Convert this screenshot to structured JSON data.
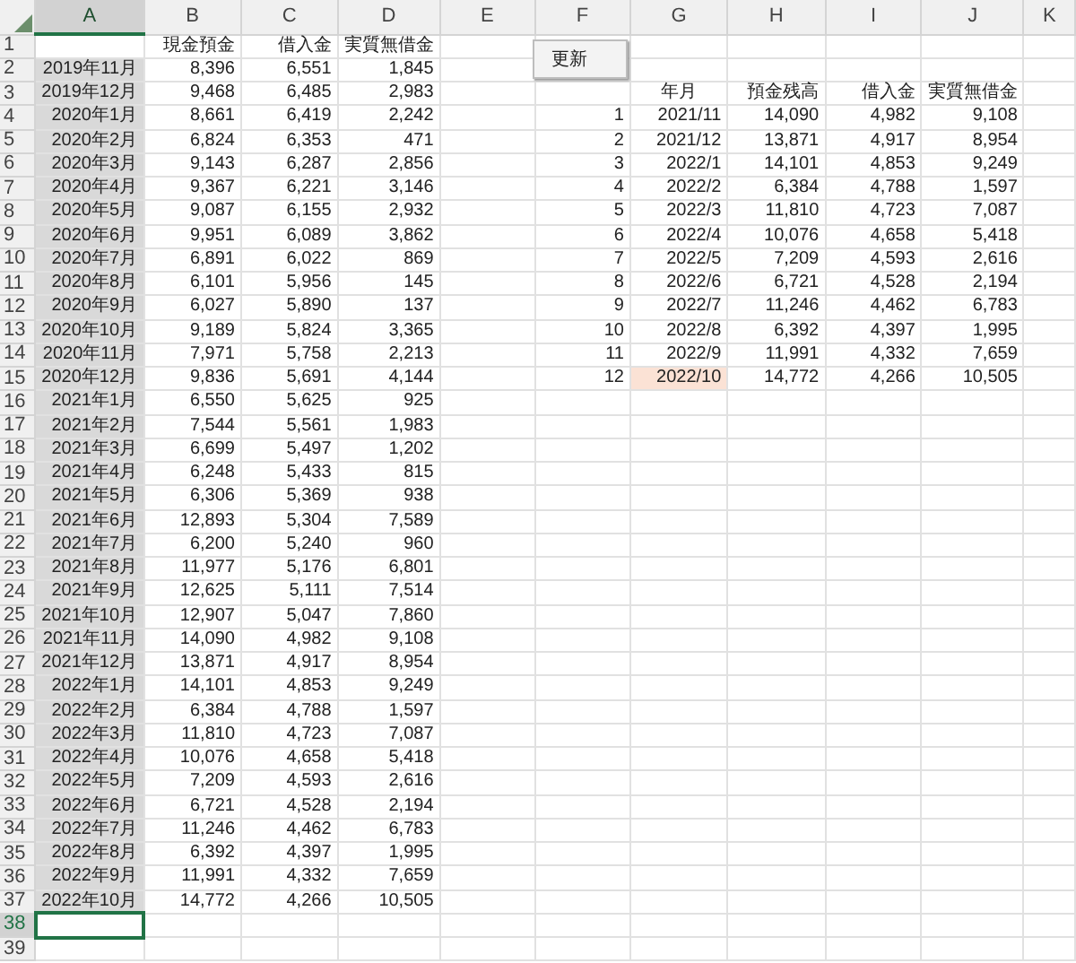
{
  "columns": [
    {
      "label": "A",
      "selected": true
    },
    {
      "label": "B",
      "selected": false
    },
    {
      "label": "C",
      "selected": false
    },
    {
      "label": "D",
      "selected": false
    },
    {
      "label": "E",
      "selected": false
    },
    {
      "label": "F",
      "selected": false
    },
    {
      "label": "G",
      "selected": false
    },
    {
      "label": "H",
      "selected": false
    },
    {
      "label": "I",
      "selected": false
    },
    {
      "label": "J",
      "selected": false
    },
    {
      "label": "K",
      "selected": false
    }
  ],
  "row_numbers": [
    {
      "label": "1",
      "selected": false
    },
    {
      "label": "2",
      "selected": false
    },
    {
      "label": "3",
      "selected": false
    },
    {
      "label": "4",
      "selected": false
    },
    {
      "label": "5",
      "selected": false
    },
    {
      "label": "6",
      "selected": false
    },
    {
      "label": "7",
      "selected": false
    },
    {
      "label": "8",
      "selected": false
    },
    {
      "label": "9",
      "selected": false
    },
    {
      "label": "10",
      "selected": false
    },
    {
      "label": "11",
      "selected": false
    },
    {
      "label": "12",
      "selected": false
    },
    {
      "label": "13",
      "selected": false
    },
    {
      "label": "14",
      "selected": false
    },
    {
      "label": "15",
      "selected": false
    },
    {
      "label": "16",
      "selected": false
    },
    {
      "label": "17",
      "selected": false
    },
    {
      "label": "18",
      "selected": false
    },
    {
      "label": "19",
      "selected": false
    },
    {
      "label": "20",
      "selected": false
    },
    {
      "label": "21",
      "selected": false
    },
    {
      "label": "22",
      "selected": false
    },
    {
      "label": "23",
      "selected": false
    },
    {
      "label": "24",
      "selected": false
    },
    {
      "label": "25",
      "selected": false
    },
    {
      "label": "26",
      "selected": false
    },
    {
      "label": "27",
      "selected": false
    },
    {
      "label": "28",
      "selected": false
    },
    {
      "label": "29",
      "selected": false
    },
    {
      "label": "30",
      "selected": false
    },
    {
      "label": "31",
      "selected": false
    },
    {
      "label": "32",
      "selected": false
    },
    {
      "label": "33",
      "selected": false
    },
    {
      "label": "34",
      "selected": false
    },
    {
      "label": "35",
      "selected": false
    },
    {
      "label": "36",
      "selected": false
    },
    {
      "label": "37",
      "selected": false
    },
    {
      "label": "38",
      "selected": true
    },
    {
      "label": "39",
      "selected": false
    }
  ],
  "button": {
    "label": "更新"
  },
  "left_table": {
    "headers": [
      "現金預金",
      "借入金",
      "実質無借金"
    ],
    "rows": [
      {
        "month": "2019年11月",
        "cash": "8,396",
        "loan": "6,551",
        "net": "1,845",
        "shaded": true
      },
      {
        "month": "2019年12月",
        "cash": "9,468",
        "loan": "6,485",
        "net": "2,983",
        "shaded": true
      },
      {
        "month": "2020年1月",
        "cash": "8,661",
        "loan": "6,419",
        "net": "2,242",
        "shaded": true
      },
      {
        "month": "2020年2月",
        "cash": "6,824",
        "loan": "6,353",
        "net": "471",
        "shaded": true
      },
      {
        "month": "2020年3月",
        "cash": "9,143",
        "loan": "6,287",
        "net": "2,856",
        "shaded": true
      },
      {
        "month": "2020年4月",
        "cash": "9,367",
        "loan": "6,221",
        "net": "3,146",
        "shaded": true
      },
      {
        "month": "2020年5月",
        "cash": "9,087",
        "loan": "6,155",
        "net": "2,932",
        "shaded": true
      },
      {
        "month": "2020年6月",
        "cash": "9,951",
        "loan": "6,089",
        "net": "3,862",
        "shaded": true
      },
      {
        "month": "2020年7月",
        "cash": "6,891",
        "loan": "6,022",
        "net": "869",
        "shaded": true
      },
      {
        "month": "2020年8月",
        "cash": "6,101",
        "loan": "5,956",
        "net": "145",
        "shaded": true
      },
      {
        "month": "2020年9月",
        "cash": "6,027",
        "loan": "5,890",
        "net": "137",
        "shaded": true
      },
      {
        "month": "2020年10月",
        "cash": "9,189",
        "loan": "5,824",
        "net": "3,365",
        "shaded": true
      },
      {
        "month": "2020年11月",
        "cash": "7,971",
        "loan": "5,758",
        "net": "2,213",
        "shaded": true
      },
      {
        "month": "2020年12月",
        "cash": "9,836",
        "loan": "5,691",
        "net": "4,144",
        "shaded": true
      },
      {
        "month": "2021年1月",
        "cash": "6,550",
        "loan": "5,625",
        "net": "925",
        "shaded": true
      },
      {
        "month": "2021年2月",
        "cash": "7,544",
        "loan": "5,561",
        "net": "1,983",
        "shaded": true
      },
      {
        "month": "2021年3月",
        "cash": "6,699",
        "loan": "5,497",
        "net": "1,202",
        "shaded": true
      },
      {
        "month": "2021年4月",
        "cash": "6,248",
        "loan": "5,433",
        "net": "815",
        "shaded": true
      },
      {
        "month": "2021年5月",
        "cash": "6,306",
        "loan": "5,369",
        "net": "938",
        "shaded": true
      },
      {
        "month": "2021年6月",
        "cash": "12,893",
        "loan": "5,304",
        "net": "7,589",
        "shaded": true
      },
      {
        "month": "2021年7月",
        "cash": "6,200",
        "loan": "5,240",
        "net": "960",
        "shaded": true
      },
      {
        "month": "2021年8月",
        "cash": "11,977",
        "loan": "5,176",
        "net": "6,801",
        "shaded": true
      },
      {
        "month": "2021年9月",
        "cash": "12,625",
        "loan": "5,111",
        "net": "7,514",
        "shaded": true
      },
      {
        "month": "2021年10月",
        "cash": "12,907",
        "loan": "5,047",
        "net": "7,860",
        "shaded": true
      },
      {
        "month": "2021年11月",
        "cash": "14,090",
        "loan": "4,982",
        "net": "9,108",
        "shaded": true
      },
      {
        "month": "2021年12月",
        "cash": "13,871",
        "loan": "4,917",
        "net": "8,954",
        "shaded": true
      },
      {
        "month": "2022年1月",
        "cash": "14,101",
        "loan": "4,853",
        "net": "9,249",
        "shaded": true
      },
      {
        "month": "2022年2月",
        "cash": "6,384",
        "loan": "4,788",
        "net": "1,597",
        "shaded": true
      },
      {
        "month": "2022年3月",
        "cash": "11,810",
        "loan": "4,723",
        "net": "7,087",
        "shaded": true
      },
      {
        "month": "2022年4月",
        "cash": "10,076",
        "loan": "4,658",
        "net": "5,418",
        "shaded": true
      },
      {
        "month": "2022年5月",
        "cash": "7,209",
        "loan": "4,593",
        "net": "2,616",
        "shaded": true
      },
      {
        "month": "2022年6月",
        "cash": "6,721",
        "loan": "4,528",
        "net": "2,194",
        "shaded": true
      },
      {
        "month": "2022年7月",
        "cash": "11,246",
        "loan": "4,462",
        "net": "6,783",
        "shaded": true
      },
      {
        "month": "2022年8月",
        "cash": "6,392",
        "loan": "4,397",
        "net": "1,995",
        "shaded": true
      },
      {
        "month": "2022年9月",
        "cash": "11,991",
        "loan": "4,332",
        "net": "7,659",
        "shaded": true
      },
      {
        "month": "2022年10月",
        "cash": "14,772",
        "loan": "4,266",
        "net": "10,505",
        "shaded": true
      }
    ]
  },
  "right_table": {
    "headers": [
      "年月",
      "預金残高",
      "借入金",
      "実質無借金"
    ],
    "rows": [
      {
        "no": "1",
        "month": "2021/11",
        "deposit": "14,090",
        "loan": "4,982",
        "net": "9,108",
        "highlighted": false
      },
      {
        "no": "2",
        "month": "2021/12",
        "deposit": "13,871",
        "loan": "4,917",
        "net": "8,954",
        "highlighted": false
      },
      {
        "no": "3",
        "month": "2022/1",
        "deposit": "14,101",
        "loan": "4,853",
        "net": "9,249",
        "highlighted": false
      },
      {
        "no": "4",
        "month": "2022/2",
        "deposit": "6,384",
        "loan": "4,788",
        "net": "1,597",
        "highlighted": false
      },
      {
        "no": "5",
        "month": "2022/3",
        "deposit": "11,810",
        "loan": "4,723",
        "net": "7,087",
        "highlighted": false
      },
      {
        "no": "6",
        "month": "2022/4",
        "deposit": "10,076",
        "loan": "4,658",
        "net": "5,418",
        "highlighted": false
      },
      {
        "no": "7",
        "month": "2022/5",
        "deposit": "7,209",
        "loan": "4,593",
        "net": "2,616",
        "highlighted": false
      },
      {
        "no": "8",
        "month": "2022/6",
        "deposit": "6,721",
        "loan": "4,528",
        "net": "2,194",
        "highlighted": false
      },
      {
        "no": "9",
        "month": "2022/7",
        "deposit": "11,246",
        "loan": "4,462",
        "net": "6,783",
        "highlighted": false
      },
      {
        "no": "10",
        "month": "2022/8",
        "deposit": "6,392",
        "loan": "4,397",
        "net": "1,995",
        "highlighted": false
      },
      {
        "no": "11",
        "month": "2022/9",
        "deposit": "11,991",
        "loan": "4,332",
        "net": "7,659",
        "highlighted": false
      },
      {
        "no": "12",
        "month": "2022/10",
        "deposit": "14,772",
        "loan": "4,266",
        "net": "10,505",
        "highlighted": true
      }
    ]
  }
}
